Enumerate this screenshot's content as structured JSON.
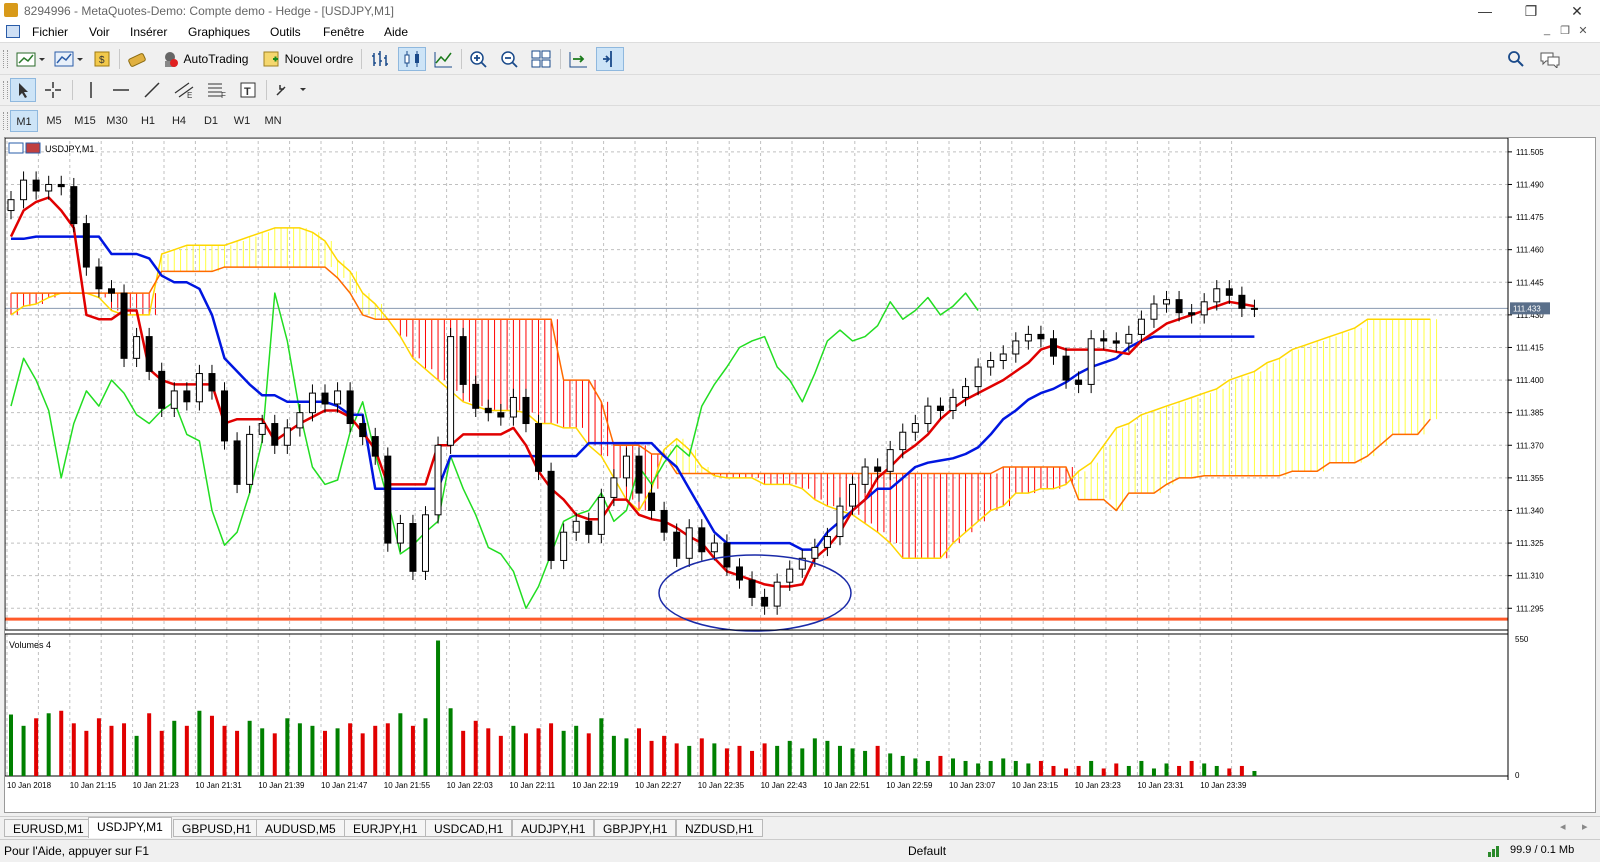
{
  "window": {
    "title": "8294996 - MetaQuotes-Demo: Compte demo - Hedge - [USDJPY,M1]",
    "minimize": "—",
    "restore": "❐",
    "close": "✕"
  },
  "menu": {
    "items": [
      "Fichier",
      "Voir",
      "Insérer",
      "Graphiques",
      "Outils",
      "Fenêtre",
      "Aide"
    ]
  },
  "toolbar": {
    "autotrading_label": "AutoTrading",
    "new_order_label": "Nouvel ordre",
    "timeframes": [
      "M1",
      "M5",
      "M15",
      "M30",
      "H1",
      "H4",
      "D1",
      "W1",
      "MN"
    ],
    "active_timeframe": "M1"
  },
  "chart": {
    "symbol_label": "USDJPY,M1",
    "volumes_label": "Volumes 4",
    "current_price_label": "111.433",
    "volume_axis_labels": [
      "550",
      "0"
    ],
    "colors": {
      "bull": "#000000",
      "bear": "#000000",
      "tenkan": "#e00000",
      "kijun": "#0016e0",
      "chikou": "#22dd22",
      "kumo_up": "#ffff40",
      "kumo_down": "#ff0000",
      "support": "#ff5a2a",
      "ellipse": "#1a2aa8",
      "vol_up": "#008000",
      "vol_down": "#e00000",
      "grid": "#c0c0c0"
    }
  },
  "chart_data": {
    "type": "candlestick",
    "symbol": "USDJPY",
    "timeframe": "M1",
    "ylim": [
      111.285,
      111.51
    ],
    "y_ticks": [
      "111.505",
      "111.490",
      "111.475",
      "111.460",
      "111.445",
      "111.430",
      "111.415",
      "111.400",
      "111.385",
      "111.370",
      "111.355",
      "111.340",
      "111.325",
      "111.310",
      "111.295"
    ],
    "x_ticks": [
      "10 Jan 2018",
      "10 Jan 21:15",
      "10 Jan 21:23",
      "10 Jan 21:31",
      "10 Jan 21:39",
      "10 Jan 21:47",
      "10 Jan 21:55",
      "10 Jan 22:03",
      "10 Jan 22:11",
      "10 Jan 22:19",
      "10 Jan 22:27",
      "10 Jan 22:35",
      "10 Jan 22:43",
      "10 Jan 22:51",
      "10 Jan 22:59",
      "10 Jan 23:07",
      "10 Jan 23:15",
      "10 Jan 23:23",
      "10 Jan 23:31",
      "10 Jan 23:39"
    ],
    "close": [
      111.483,
      111.492,
      111.487,
      111.49,
      111.489,
      111.472,
      111.452,
      111.442,
      111.44,
      111.41,
      111.42,
      111.404,
      111.387,
      111.395,
      111.39,
      111.403,
      111.395,
      111.372,
      111.352,
      111.375,
      111.38,
      111.37,
      111.378,
      111.385,
      111.394,
      111.389,
      111.395,
      111.38,
      111.374,
      111.365,
      111.325,
      111.334,
      111.312,
      111.338,
      111.37,
      111.42,
      111.398,
      111.387,
      111.385,
      111.383,
      111.392,
      111.38,
      111.358,
      111.317,
      111.33,
      111.335,
      111.329,
      111.346,
      111.355,
      111.365,
      111.348,
      111.34,
      111.33,
      111.318,
      111.332,
      111.321,
      111.325,
      111.314,
      111.308,
      111.3,
      111.296,
      111.307,
      111.313,
      111.318,
      111.323,
      111.328,
      111.342,
      111.352,
      111.36,
      111.358,
      111.368,
      111.376,
      111.38,
      111.388,
      111.386,
      111.392,
      111.397,
      111.406,
      111.409,
      111.412,
      111.418,
      111.421,
      111.419,
      111.411,
      111.4,
      111.398,
      111.419,
      111.418,
      111.417,
      111.421,
      111.428,
      111.435,
      111.437,
      111.431,
      111.43,
      111.436,
      111.442,
      111.439,
      111.433,
      111.433
    ],
    "open": [
      111.478,
      111.483,
      111.492,
      111.487,
      111.49,
      111.489,
      111.472,
      111.452,
      111.442,
      111.44,
      111.41,
      111.42,
      111.404,
      111.387,
      111.395,
      111.39,
      111.403,
      111.395,
      111.372,
      111.352,
      111.375,
      111.38,
      111.37,
      111.378,
      111.385,
      111.394,
      111.389,
      111.395,
      111.38,
      111.374,
      111.365,
      111.325,
      111.334,
      111.312,
      111.338,
      111.37,
      111.42,
      111.398,
      111.387,
      111.385,
      111.383,
      111.392,
      111.38,
      111.358,
      111.317,
      111.33,
      111.335,
      111.329,
      111.346,
      111.355,
      111.365,
      111.348,
      111.34,
      111.33,
      111.318,
      111.332,
      111.321,
      111.325,
      111.314,
      111.308,
      111.3,
      111.296,
      111.307,
      111.313,
      111.318,
      111.323,
      111.328,
      111.342,
      111.352,
      111.36,
      111.358,
      111.368,
      111.376,
      111.38,
      111.388,
      111.386,
      111.392,
      111.397,
      111.406,
      111.409,
      111.412,
      111.418,
      111.421,
      111.419,
      111.411,
      111.4,
      111.398,
      111.419,
      111.418,
      111.417,
      111.421,
      111.428,
      111.435,
      111.437,
      111.431,
      111.43,
      111.436,
      111.442,
      111.439,
      111.433
    ],
    "volume": [
      245,
      200,
      230,
      250,
      260,
      210,
      180,
      230,
      200,
      210,
      160,
      250,
      180,
      220,
      200,
      260,
      240,
      200,
      180,
      220,
      190,
      170,
      230,
      210,
      200,
      180,
      190,
      210,
      170,
      200,
      210,
      250,
      200,
      230,
      540,
      270,
      180,
      220,
      190,
      160,
      200,
      170,
      190,
      210,
      180,
      200,
      170,
      230,
      160,
      150,
      190,
      140,
      160,
      130,
      120,
      150,
      130,
      110,
      120,
      100,
      130,
      120,
      140,
      110,
      150,
      140,
      120,
      110,
      100,
      120,
      90,
      80,
      70,
      60,
      80,
      70,
      60,
      50,
      60,
      70,
      60,
      50,
      60,
      40,
      30,
      40,
      60,
      30,
      50,
      40,
      60,
      30,
      50,
      40,
      60,
      50,
      40,
      30,
      40,
      20
    ],
    "series": [
      {
        "name": "Tenkan-sen",
        "values": [
          111.466,
          111.478,
          111.482,
          111.484,
          111.478,
          111.47,
          111.43,
          111.428,
          111.428,
          111.432,
          111.432,
          111.405,
          111.4,
          111.398,
          111.398,
          111.398,
          111.398,
          111.38,
          111.382,
          111.382,
          111.382,
          111.372,
          111.376,
          111.38,
          111.383,
          111.386,
          111.386,
          111.383,
          111.376,
          111.368,
          111.352,
          111.352,
          111.352,
          111.352,
          111.37,
          111.37,
          111.375,
          111.375,
          111.375,
          111.375,
          111.378,
          111.37,
          111.358,
          111.35,
          111.345,
          111.338,
          111.336,
          111.336,
          111.345,
          111.345,
          111.338,
          111.336,
          111.335,
          111.332,
          111.328,
          111.325,
          111.318,
          111.312,
          111.31,
          111.308,
          111.306,
          111.305,
          111.305,
          111.306,
          111.318,
          111.323,
          111.33,
          111.34,
          111.345,
          111.355,
          111.36,
          111.366,
          111.37,
          111.375,
          111.382,
          111.387,
          111.391,
          111.394,
          111.397,
          111.4,
          111.404,
          111.408,
          111.414,
          111.416,
          111.414,
          111.414,
          111.414,
          111.414,
          111.413,
          111.412,
          111.418,
          111.422,
          111.426,
          111.428,
          111.43,
          111.432,
          111.434,
          111.436,
          111.435,
          111.434
        ]
      },
      {
        "name": "Kijun-sen",
        "values": [
          111.465,
          111.465,
          111.466,
          111.466,
          111.466,
          111.466,
          111.466,
          111.466,
          111.458,
          111.458,
          111.458,
          111.456,
          111.448,
          111.445,
          111.445,
          111.442,
          111.43,
          111.41,
          111.404,
          111.398,
          111.393,
          111.393,
          111.39,
          111.39,
          111.39,
          111.39,
          111.388,
          111.384,
          111.384,
          111.35,
          111.35,
          111.35,
          111.35,
          111.35,
          111.35,
          111.365,
          111.365,
          111.365,
          111.365,
          111.365,
          111.365,
          111.365,
          111.365,
          111.365,
          111.365,
          111.365,
          111.371,
          111.371,
          111.371,
          111.371,
          111.371,
          111.371,
          111.365,
          111.36,
          111.35,
          111.34,
          111.33,
          111.325,
          111.325,
          111.325,
          111.325,
          111.325,
          111.325,
          111.322,
          111.322,
          111.33,
          111.335,
          111.34,
          111.345,
          111.35,
          111.35,
          111.355,
          111.36,
          111.362,
          111.363,
          111.364,
          111.366,
          111.369,
          111.375,
          111.382,
          111.386,
          111.391,
          111.394,
          111.396,
          111.399,
          111.403,
          111.406,
          111.408,
          111.41,
          111.415,
          111.418,
          111.42,
          111.42,
          111.42,
          111.42,
          111.42,
          111.42,
          111.42,
          111.42,
          111.42
        ]
      },
      {
        "name": "Chikou Span",
        "values": [
          111.388,
          111.41,
          111.4,
          111.386,
          111.355,
          111.38,
          111.395,
          111.388,
          111.4,
          111.394,
          111.384,
          111.38,
          111.386,
          111.39,
          111.375,
          111.372,
          111.34,
          111.324,
          111.33,
          111.348,
          111.372,
          111.44,
          111.418,
          111.385,
          111.36,
          111.352,
          111.354,
          111.376,
          111.39,
          111.366,
          111.345,
          111.32,
          111.324,
          111.33,
          111.335,
          111.365,
          111.35,
          111.338,
          111.323,
          111.32,
          111.312,
          111.295,
          111.305,
          111.32,
          111.335,
          111.338,
          111.34,
          111.348,
          111.335,
          111.34,
          111.36,
          111.352,
          111.362,
          111.37,
          111.365,
          111.388,
          111.398,
          111.406,
          111.415,
          111.418,
          111.42,
          111.406,
          111.4,
          111.39,
          111.403,
          111.418,
          111.423,
          111.418,
          111.42,
          111.425,
          111.436,
          111.428,
          111.432,
          111.438,
          111.43,
          111.434,
          111.44,
          111.432
        ]
      },
      {
        "name": "Senkou Span A",
        "values": [
          111.43,
          111.434,
          111.435,
          111.438,
          111.44,
          111.44,
          111.44,
          111.438,
          111.432,
          111.43,
          111.43,
          111.43,
          111.458,
          111.46,
          111.462,
          111.462,
          111.462,
          111.462,
          111.464,
          111.466,
          111.468,
          111.47,
          111.47,
          111.47,
          111.468,
          111.464,
          111.455,
          111.45,
          111.44,
          111.435,
          111.428,
          111.42,
          111.41,
          111.405,
          111.4,
          111.395,
          111.39,
          111.388,
          111.386,
          111.386,
          111.386,
          111.385,
          111.38,
          111.38,
          111.378,
          111.378,
          111.37,
          111.365,
          111.355,
          111.345,
          111.34,
          111.35,
          111.368,
          111.373,
          111.368,
          111.36,
          111.356,
          111.355,
          111.355,
          111.355,
          111.352,
          111.352,
          111.352,
          111.35,
          111.345,
          111.342,
          111.34,
          111.338,
          111.334,
          111.33,
          111.325,
          111.318,
          111.318,
          111.318,
          111.318,
          111.325,
          111.33,
          111.335,
          111.34,
          111.342,
          111.348,
          111.348,
          111.35,
          111.35,
          111.352,
          111.358,
          111.362,
          111.37,
          111.378,
          111.38,
          111.384,
          111.386,
          111.388,
          111.39,
          111.392,
          111.394,
          111.396,
          111.4,
          111.402,
          111.404,
          111.408,
          111.41,
          111.414,
          111.416,
          111.418,
          111.42,
          111.422,
          111.424,
          111.428,
          111.428,
          111.428,
          111.428,
          111.428,
          111.428
        ]
      },
      {
        "name": "Senkou Span B",
        "values": [
          111.44,
          111.44,
          111.44,
          111.44,
          111.44,
          111.44,
          111.44,
          111.44,
          111.44,
          111.44,
          111.44,
          111.44,
          111.45,
          111.45,
          111.45,
          111.45,
          111.45,
          111.452,
          111.452,
          111.452,
          111.452,
          111.452,
          111.452,
          111.452,
          111.452,
          111.452,
          111.447,
          111.44,
          111.43,
          111.428,
          111.428,
          111.428,
          111.428,
          111.428,
          111.428,
          111.428,
          111.428,
          111.428,
          111.428,
          111.428,
          111.428,
          111.428,
          111.428,
          111.428,
          111.4,
          111.4,
          111.4,
          111.39,
          111.37,
          111.37,
          111.37,
          111.366,
          111.366,
          111.357,
          111.357,
          111.357,
          111.357,
          111.357,
          111.357,
          111.357,
          111.357,
          111.357,
          111.357,
          111.357,
          111.357,
          111.357,
          111.357,
          111.357,
          111.357,
          111.357,
          111.357,
          111.357,
          111.357,
          111.357,
          111.357,
          111.357,
          111.357,
          111.357,
          111.357,
          111.36,
          111.36,
          111.36,
          111.36,
          111.36,
          111.36,
          111.345,
          111.345,
          111.345,
          111.34,
          111.348,
          111.348,
          111.348,
          111.352,
          111.355,
          111.355,
          111.356,
          111.356,
          111.356,
          111.356,
          111.356,
          111.356,
          111.356,
          111.358,
          111.358,
          111.358,
          111.362,
          111.362,
          111.362,
          111.365,
          111.37,
          111.375,
          111.375,
          111.375,
          111.382
        ]
      }
    ],
    "support_level": 111.29
  },
  "symbol_tabs": [
    "EURUSD,M1",
    "USDJPY,M1",
    "GBPUSD,H1",
    "AUDUSD,M5",
    "EURJPY,H1",
    "USDCAD,H1",
    "AUDJPY,H1",
    "GBPJPY,H1",
    "NZDUSD,H1"
  ],
  "active_tab": "USDJPY,M1",
  "status": {
    "help": "Pour l'Aide, appuyer sur F1",
    "profile": "Default",
    "traffic": "99.9 / 0.1 Mb"
  }
}
